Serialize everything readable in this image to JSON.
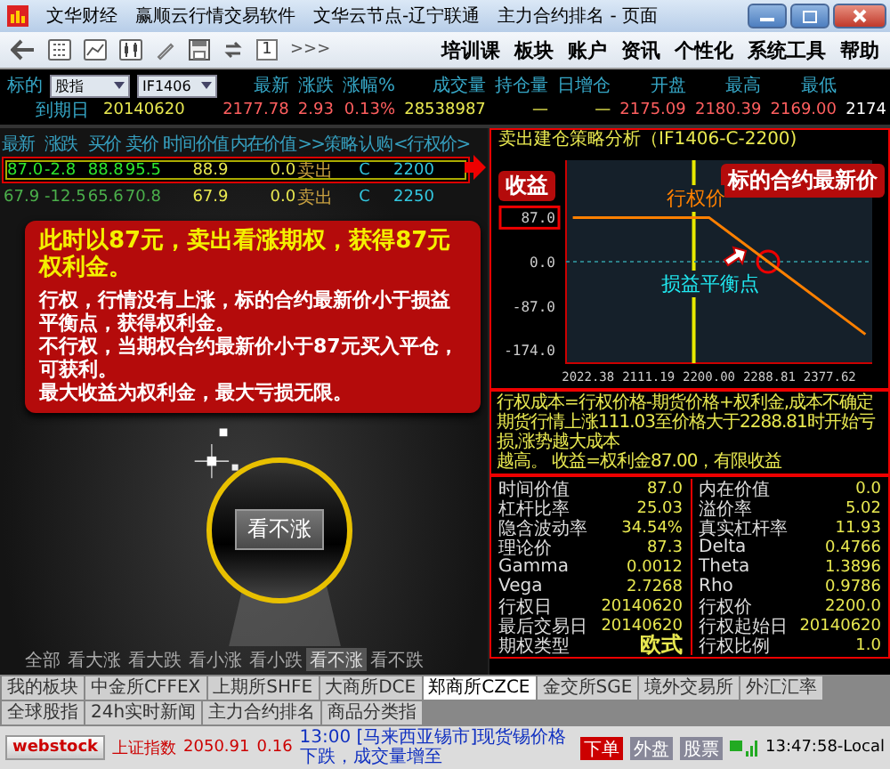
{
  "window": {
    "title_parts": [
      "文华财经",
      "赢顺云行情交易软件",
      "文华云节点-辽宁联通",
      "主力合约排名 - 页面"
    ]
  },
  "toolbar": {
    "page_number": "1",
    "more": ">>>",
    "menu": [
      "培训课",
      "板块",
      "账户",
      "资讯",
      "个性化",
      "系统工具",
      "帮助"
    ]
  },
  "quote": {
    "label": "标的",
    "category": "股指",
    "contract": "IF1406",
    "columns": [
      "最新",
      "涨跌",
      "涨幅%",
      "成交量",
      "持仓量",
      "日增仓",
      "开盘",
      "最高",
      "最低"
    ],
    "expiry_label": "到期日",
    "expiry": "20140620",
    "values": [
      "2177.78",
      "2.93",
      "0.13%",
      "28538987",
      "—",
      "—",
      "2175.09",
      "2180.39",
      "2169.00",
      "2174"
    ]
  },
  "option_table": {
    "columns": [
      "最新",
      "涨跌",
      "买价",
      "卖价",
      "时间价值",
      "内在价值",
      ">>策略",
      "认购",
      "<行权价>"
    ],
    "rows": [
      {
        "selected": true,
        "cells": [
          "87.0",
          "-2.8",
          "88.8",
          "95.5",
          "88.9",
          "0.0",
          "卖出",
          "C",
          "2200"
        ]
      },
      {
        "selected": false,
        "cells": [
          "67.9",
          "-12.5",
          "65.6",
          "70.8",
          "67.9",
          "0.0",
          "卖出",
          "C",
          "2250"
        ]
      }
    ]
  },
  "callout": {
    "headline": "此时以87元，卖出看涨期权，获得87元权利金。",
    "paragraphs": [
      "行权，行情没有上涨，标的合约最新价小于损益平衡点，获得权利金。",
      "不行权，当期权合约最新价小于87元买入平仓，可获利。",
      "最大收益为权利金，最大亏损无限。"
    ]
  },
  "spotlight": {
    "button": "看不涨"
  },
  "strategy_tabs": [
    {
      "label": "全部",
      "selected": false
    },
    {
      "label": "看大涨",
      "selected": false
    },
    {
      "label": "看大跌",
      "selected": false
    },
    {
      "label": "看小涨",
      "selected": false
    },
    {
      "label": "看小跌",
      "selected": false
    },
    {
      "label": "看不涨",
      "selected": true
    },
    {
      "label": "看不跌",
      "selected": false
    }
  ],
  "analysis": {
    "title": "卖出建仓策略分析（IF1406-C-2200)",
    "chart_data": {
      "type": "line",
      "x": [
        2000,
        2200,
        2287,
        2430
      ],
      "series": [
        {
          "name": "收益",
          "color": "#ff8000",
          "values": [
            87,
            87,
            0,
            -143
          ]
        }
      ],
      "xlim": [
        1990,
        2440
      ],
      "ylim": [
        -200,
        200
      ],
      "xticks": [
        {
          "value": 2022.38,
          "label": "2022.38"
        },
        {
          "value": 2111.19,
          "label": "2111.19"
        },
        {
          "value": 2200,
          "label": "2200.00"
        },
        {
          "value": 2288.81,
          "label": "2288.81"
        },
        {
          "value": 2377.62,
          "label": "2377.62"
        }
      ],
      "yticks": [
        {
          "value": 87,
          "label": "87.0"
        },
        {
          "value": 0,
          "label": "0.0"
        },
        {
          "value": -87,
          "label": "-87.0"
        },
        {
          "value": -174,
          "label": "-174.0"
        }
      ],
      "ref_lines": [
        {
          "axis": "x",
          "value": 2177.78,
          "color": "#e8e800"
        },
        {
          "axis": "y",
          "value": 0,
          "color": "#2b7f88"
        }
      ],
      "annotations": [
        "标的合约最新价",
        {
          "text": "行权价",
          "x": 2200,
          "y": 87
        },
        {
          "text": "损益平衡点",
          "x": 2287,
          "y": 0
        }
      ]
    },
    "notes": [
      "行权成本=行权价格-期货价格+权利金,成本不确定",
      "期货行情上涨111.03至价格大于2288.81时开始亏损,涨势越大成本",
      "越高。 收益=权利金87.00，有限收益"
    ],
    "metrics_left": [
      {
        "name": "时间价值",
        "value": "87.0"
      },
      {
        "name": "杠杆比率",
        "value": "25.03"
      },
      {
        "name": "隐含波动率",
        "value": "34.54%"
      },
      {
        "name": "理论价",
        "value": "87.3"
      },
      {
        "name": "Gamma",
        "value": "0.0012"
      },
      {
        "name": "Vega",
        "value": "2.7268"
      },
      {
        "name": "行权日",
        "value": "20140620"
      },
      {
        "name": "最后交易日",
        "value": "20140620"
      },
      {
        "name": "期权类型",
        "value": "欧式"
      }
    ],
    "metrics_right": [
      {
        "name": "内在价值",
        "value": "0.0"
      },
      {
        "name": "溢价率",
        "value": "5.02"
      },
      {
        "name": "真实杠杆率",
        "value": "11.93"
      },
      {
        "name": "Delta",
        "value": "0.4766"
      },
      {
        "name": "Theta",
        "value": "1.3896"
      },
      {
        "name": "Rho",
        "value": "0.9786"
      },
      {
        "name": "行权价",
        "value": "2200.0"
      },
      {
        "name": "行权起始日",
        "value": "20140620"
      },
      {
        "name": "行权比例",
        "value": "1.0"
      }
    ]
  },
  "exchange_tabs": [
    {
      "label": "我的板块",
      "selected": false
    },
    {
      "label": "中金所CFFEX",
      "selected": false
    },
    {
      "label": "上期所SHFE",
      "selected": false
    },
    {
      "label": "大商所DCE",
      "selected": false
    },
    {
      "label": "郑商所CZCE",
      "selected": true
    },
    {
      "label": "金交所SGE",
      "selected": false
    },
    {
      "label": "境外交易所",
      "selected": false
    },
    {
      "label": "外汇汇率",
      "selected": false
    },
    {
      "label": "全球股指",
      "selected": false
    },
    {
      "label": "24h实时新闻",
      "selected": false
    },
    {
      "label": "主力合约排名",
      "selected": false
    },
    {
      "label": "商品分类指",
      "selected": false
    }
  ],
  "status_bar": {
    "logo": "webstock",
    "index_name": "上证指数",
    "index_value": "2050.91",
    "index_change": "0.16",
    "news": "13:00 [马来西亚锡市]现货锡价格下跌，成交量增至",
    "buttons": [
      {
        "label": "下单",
        "active": true
      },
      {
        "label": "外盘",
        "active": false
      },
      {
        "label": "股票",
        "active": false
      }
    ],
    "time": "13:47:58-Local"
  }
}
